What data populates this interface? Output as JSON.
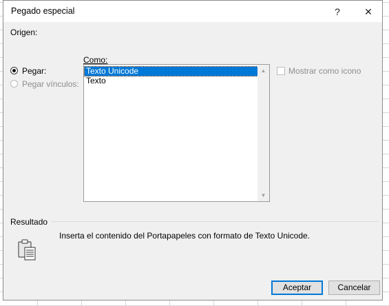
{
  "dialog": {
    "title": "Pegado especial",
    "help_label": "?",
    "close_label": "✕"
  },
  "origin": {
    "label": "Origen:"
  },
  "options": {
    "paste_label": "Pegar:",
    "paste_selected": true,
    "paste_links_label": "Pegar vínculos:",
    "paste_links_enabled": false
  },
  "como": {
    "label": "Como:",
    "items": [
      "Texto Unicode",
      "Texto"
    ],
    "selected_index": 0
  },
  "show_as_icon": {
    "label": "Mostrar como icono",
    "checked": false,
    "enabled": false
  },
  "result": {
    "label": "Resultado",
    "description": "Inserta el contenido del Portapapeles con formato de Texto Unicode.",
    "icon": "clipboard-icon"
  },
  "buttons": {
    "ok_label": "Aceptar",
    "cancel_label": "Cancelar"
  },
  "colors": {
    "selection": "#0078d7",
    "dialog_bg": "#f0f0f0",
    "disabled_text": "#8d8d8d"
  }
}
